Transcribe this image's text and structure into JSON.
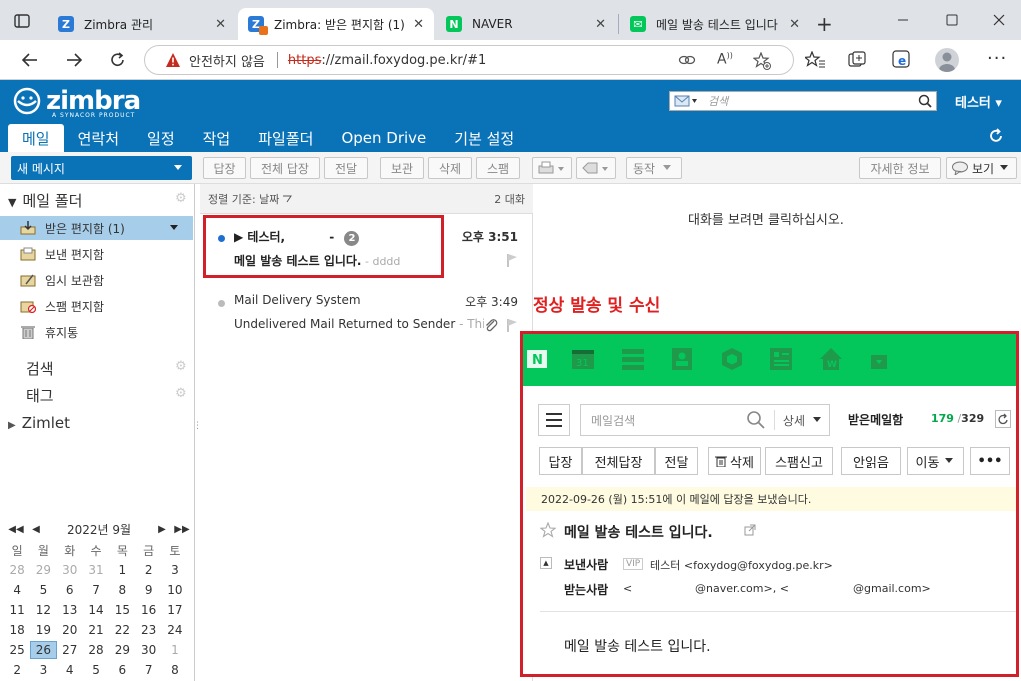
{
  "browser": {
    "tabs": [
      {
        "title": "Zimbra 관리",
        "fav_color": "#2b7bd6",
        "fav_text": "Z"
      },
      {
        "title": "Zimbra: 받은 편지함 (1)",
        "fav_color": "#2b7bd6",
        "fav_text": "Z"
      },
      {
        "title": "NAVER",
        "fav_color": "#03c75a",
        "fav_text": "N"
      },
      {
        "title": "메일 발송 테스트 입니다",
        "fav_color": "#03c75a",
        "fav_text": "✉"
      }
    ],
    "close_glyph": "✕",
    "new_tab_glyph": "+",
    "security_text": "안전하지 않음",
    "url_scheme": "https",
    "url_rest": "://zmail.foxydog.pe.kr/#1"
  },
  "zimbra": {
    "logo_text": "zimbra",
    "logo_sub": "A SYNACOR PRODUCT",
    "search_placeholder": "검색",
    "user": "테스터 ▾",
    "app_tabs": [
      "메일",
      "연락처",
      "일정",
      "작업",
      "파일폴더",
      "Open Drive",
      "기본 설정"
    ],
    "new_message": "새 메시지",
    "toolbar": {
      "reply": "답장",
      "reply_all": "전체 답장",
      "forward": "전달",
      "archive": "보관",
      "delete": "삭제",
      "spam": "스팸",
      "actions": "동작",
      "detail": "자세한 정보",
      "view": "보기"
    },
    "mail_folders_title": "메일 폴더",
    "folders": [
      {
        "label": "받은 편지함 (1)",
        "icon": "inbox-icon"
      },
      {
        "label": "보낸 편지함",
        "icon": "sent-icon"
      },
      {
        "label": "임시 보관함",
        "icon": "drafts-icon"
      },
      {
        "label": "스팸 편지함",
        "icon": "junk-icon"
      },
      {
        "label": "휴지통",
        "icon": "trash-icon"
      }
    ],
    "search_section": "검색",
    "tags_section": "태그",
    "zimlet_section": "Zimlet",
    "calendar": {
      "month_label": "2022년 9월",
      "weekdays": [
        "일",
        "월",
        "화",
        "수",
        "목",
        "금",
        "토"
      ],
      "weeks": [
        [
          "28",
          "29",
          "30",
          "31",
          "1",
          "2",
          "3"
        ],
        [
          "4",
          "5",
          "6",
          "7",
          "8",
          "9",
          "10"
        ],
        [
          "11",
          "12",
          "13",
          "14",
          "15",
          "16",
          "17"
        ],
        [
          "18",
          "19",
          "20",
          "21",
          "22",
          "23",
          "24"
        ],
        [
          "25",
          "26",
          "27",
          "28",
          "29",
          "30",
          "1"
        ],
        [
          "2",
          "3",
          "4",
          "5",
          "6",
          "7",
          "8"
        ]
      ],
      "today": "26"
    },
    "sort_label": "정렬 기준: 날짜",
    "conversation_count": "2 대화",
    "messages": [
      {
        "from": "▶ 테스터,",
        "dash": "-",
        "count": "2",
        "time": "오후 3:51",
        "subject": "메일 발송 테스트 입니다.",
        "fragment": " - dddd",
        "unread": true
      },
      {
        "from": "Mail Delivery System",
        "time": "오후 3:49",
        "subject": "Undelivered Mail Returned to Sender",
        "fragment": " - This",
        "unread": false
      }
    ],
    "reading_hint": "대화를 보려면 클릭하십시오."
  },
  "annotation": "정상 발송 및 수신",
  "naver": {
    "search_placeholder": "메일검색",
    "detail_label": "상세",
    "mailbox_label": "받은메일함",
    "unread_count": "179",
    "total_count": "329",
    "buttons": [
      "답장",
      "전체답장",
      "전달",
      "삭제",
      "스팸신고",
      "안읽음",
      "이동",
      "•••"
    ],
    "notice": "2022-09-26 (월) 15:51에 이 메일에 답장을 보냈습니다.",
    "subject": "메일 발송 테스트 입니다.",
    "sender_label": "보낸사람",
    "vip_label": "VIP",
    "sender": "테스터 <foxydog@foxydog.pe.kr>",
    "recipient_label": "받는사람",
    "recipient_prefix": "<",
    "recipient_1": "@naver.com>, <",
    "recipient_2": "@gmail.com>",
    "body": "메일 발송 테스트 입니다."
  },
  "colors": {
    "zimbra_blue": "#0a73b8",
    "naver_green": "#03c75a",
    "highlight_red": "#d1202a"
  }
}
